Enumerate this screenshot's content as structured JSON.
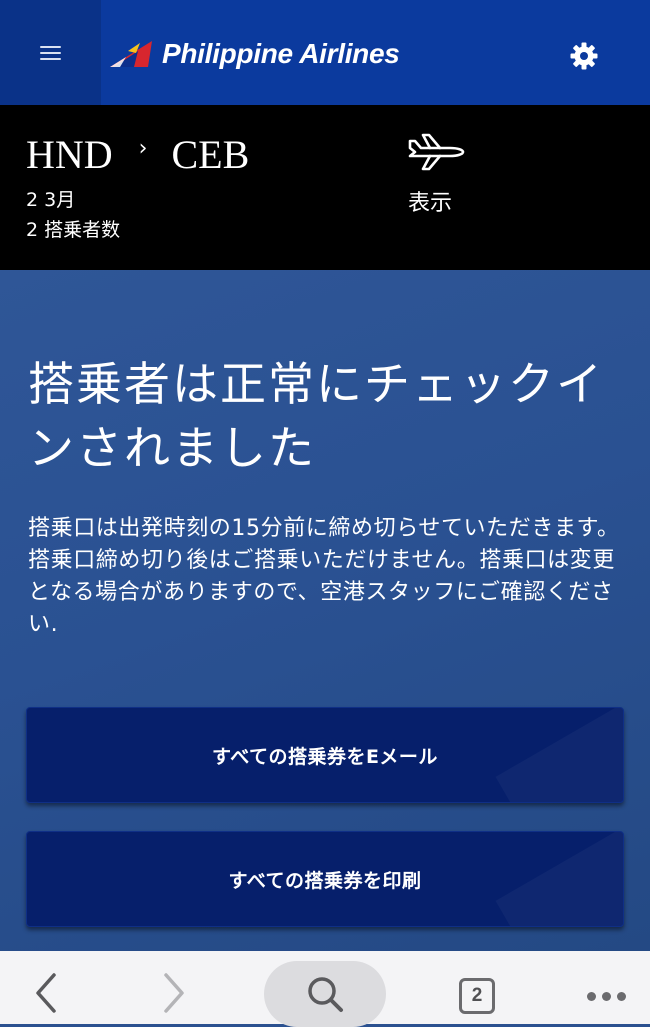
{
  "header": {
    "brand": "Philippine Airlines"
  },
  "flight": {
    "origin": "HND",
    "destination": "CEB",
    "date": "2 3月",
    "passengers": "2 搭乗者数",
    "view_label": "表示"
  },
  "main": {
    "title": "搭乗者は正常にチェックインされました",
    "message": "搭乗口は出発時刻の15分前に締め切らせていただきます。搭乗口締め切り後はご搭乗いただけません。搭乗口は変更となる場合がありますので、空港スタッフにご確認ください.",
    "email_button": "すべての搭乗券をEメール",
    "print_button": "すべての搭乗券を印刷"
  },
  "browser": {
    "tab_count": "2"
  },
  "colors": {
    "header_bg": "#0b3a9e",
    "menu_bg": "#0a3288",
    "flight_bar_bg": "#000000",
    "content_bg": "#2b5190",
    "button_bg": "#061f6b",
    "toolbar_bg": "#f4f4f6"
  },
  "icons": {
    "menu": "hamburger-icon",
    "logo": "airline-logo-icon",
    "settings": "gear-icon",
    "route_separator": "chevron-right-icon",
    "view": "airplane-icon",
    "back": "chevron-left-icon",
    "forward": "chevron-right-icon",
    "search": "search-icon",
    "tabs": "tabs-icon",
    "more": "more-dots-icon"
  }
}
